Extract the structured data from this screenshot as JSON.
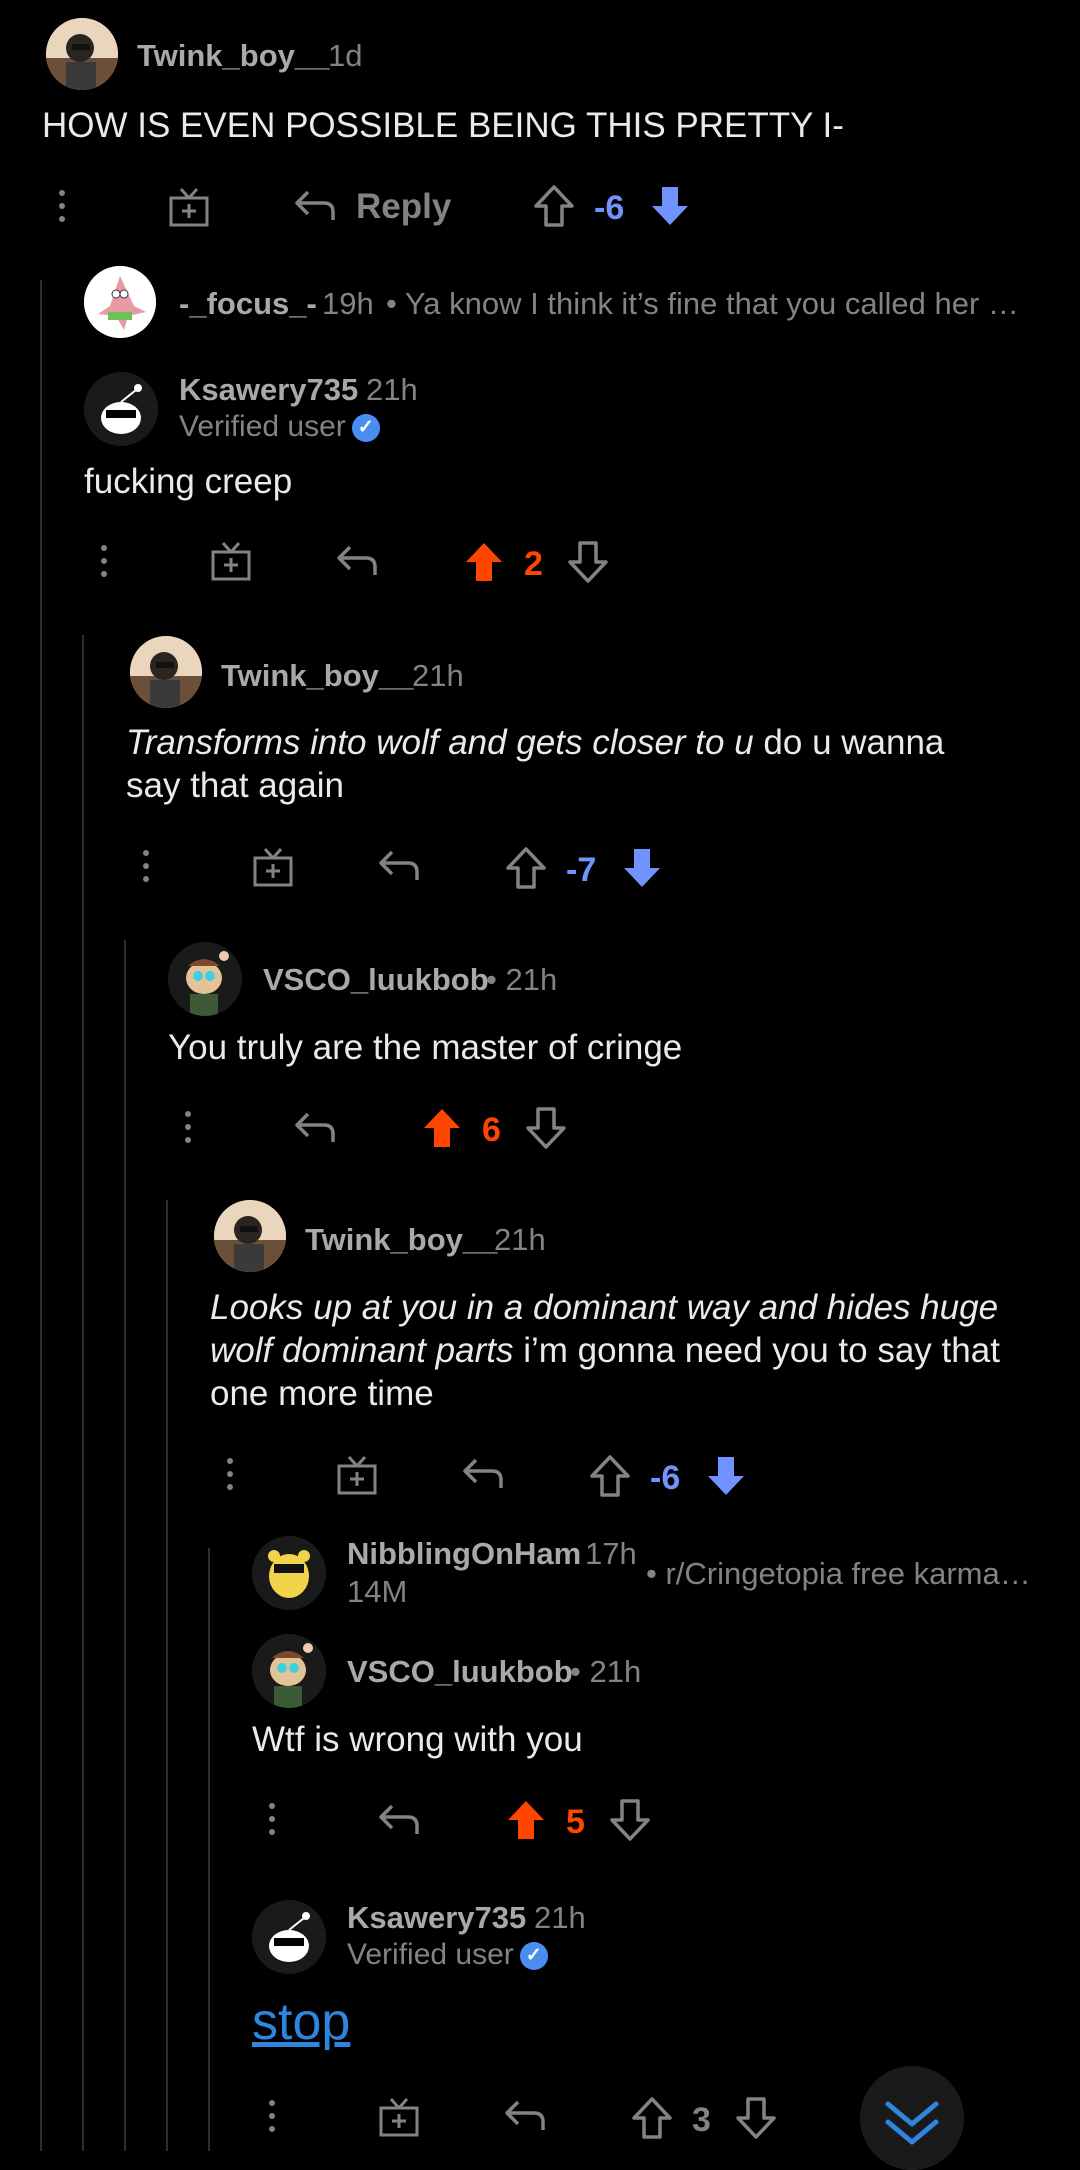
{
  "top_comment": {
    "username": "Twink_boy__",
    "age": "1d",
    "text": "HOW IS EVEN POSSIBLE BEING THIS PRETTY I-",
    "reply_label": "Reply",
    "score": "-6"
  },
  "collapsed_1": {
    "username": "-_focus_-",
    "age": "19h",
    "preview": "• Ya know I think it’s fine that you called her …"
  },
  "c_ksawery_1": {
    "username": "Ksawery735",
    "age": "21h",
    "flair": "Verified user",
    "text": "fucking creep",
    "score": "2"
  },
  "c_twink_2": {
    "username": "Twink_boy__",
    "age": "21h",
    "text_italic": "Transforms into wolf and gets closer to u",
    "text_plain_1": " do u wanna",
    "text_plain_2": "say that again",
    "score": "-7"
  },
  "c_vsco_1": {
    "username": "VSCO_luukbob",
    "age": "• 21h",
    "text": "You truly are the master of cringe",
    "score": "6"
  },
  "c_twink_3": {
    "username": "Twink_boy__",
    "age": "21h",
    "text_italic_1": "Looks up at you in a dominant way and hides huge",
    "text_italic_2": "wolf dominant parts",
    "text_plain_2": " i’m gonna need you to say that",
    "text_plain_3": "one more time",
    "score": "-6"
  },
  "collapsed_2": {
    "username": "NibblingOnHam",
    "age": "17h",
    "flair": "14M",
    "preview": "• r/Cringetopia free karma…"
  },
  "c_vsco_2": {
    "username": "VSCO_luukbob",
    "age": "• 21h",
    "text": "Wtf is wrong with you",
    "score": "5"
  },
  "c_ksawery_2": {
    "username": "Ksawery735",
    "age": "21h",
    "flair": "Verified user",
    "text": "stop",
    "score": "3"
  },
  "colors": {
    "upvote_active": "#ff4500",
    "downvote_active": "#7193ff",
    "link": "#2e86de",
    "background": "#000000"
  },
  "icons": [
    "more-icon",
    "award-icon",
    "reply-icon",
    "upvote-icon",
    "downvote-icon",
    "verified-icon",
    "scroll-down-icon"
  ]
}
